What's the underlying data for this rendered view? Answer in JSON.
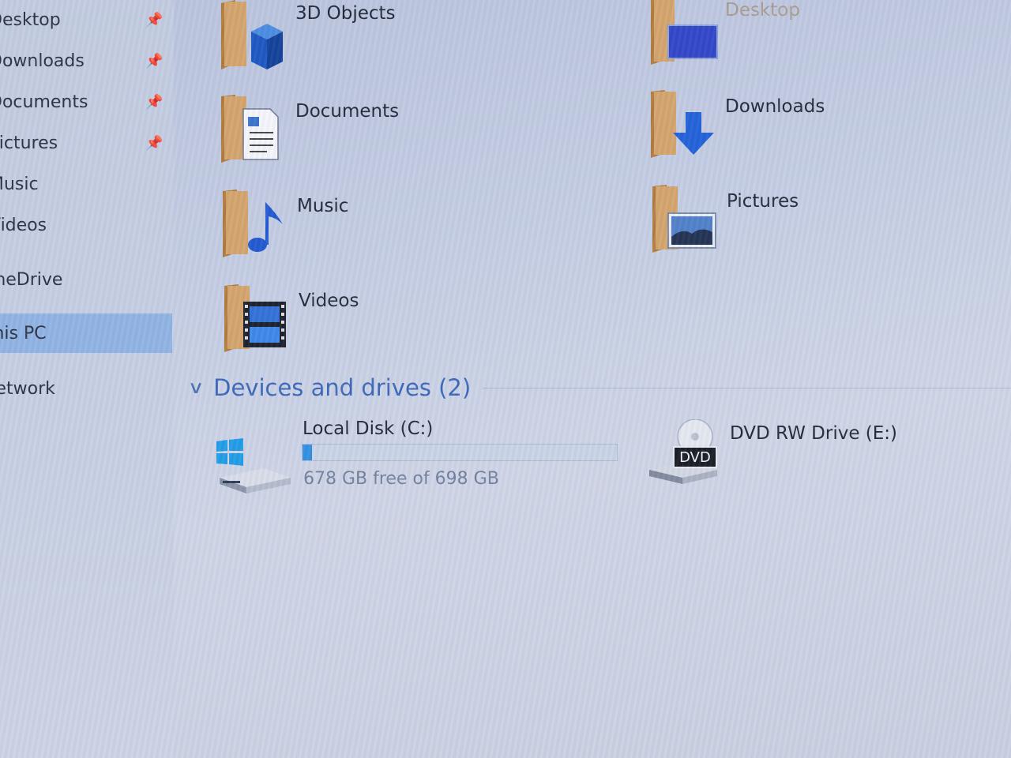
{
  "nav": {
    "items": [
      {
        "label": "Desktop",
        "pinned": true
      },
      {
        "label": "Downloads",
        "pinned": true
      },
      {
        "label": "Documents",
        "pinned": true
      },
      {
        "label": "Pictures",
        "pinned": true
      },
      {
        "label": "Music",
        "pinned": false
      },
      {
        "label": "Videos",
        "pinned": false
      },
      {
        "label": "OneDrive",
        "pinned": false
      },
      {
        "label": "This PC",
        "pinned": false,
        "selected": true
      },
      {
        "label": "Network",
        "pinned": false
      }
    ],
    "pin_glyph": "📌"
  },
  "folders": [
    {
      "label": "3D Objects",
      "icon": "3d-objects-folder-icon"
    },
    {
      "label": "Desktop",
      "icon": "desktop-folder-icon"
    },
    {
      "label": "Documents",
      "icon": "documents-folder-icon"
    },
    {
      "label": "Downloads",
      "icon": "downloads-folder-icon"
    },
    {
      "label": "Music",
      "icon": "music-folder-icon"
    },
    {
      "label": "Pictures",
      "icon": "pictures-folder-icon"
    },
    {
      "label": "Videos",
      "icon": "videos-folder-icon"
    }
  ],
  "devices": {
    "chevron": "∨",
    "title": "Devices and drives (2)",
    "drives": [
      {
        "name": "Local Disk (C:)",
        "free_text": "678 GB free of 698 GB",
        "used_fraction": 0.029,
        "icon": "windows-drive-icon"
      },
      {
        "name": "DVD RW Drive (E:)",
        "badge": "DVD",
        "icon": "dvd-drive-icon"
      }
    ]
  },
  "colors": {
    "accent": "#3a66b8",
    "selection": "#8fb3e3",
    "usage_fill": "#2f8ee0"
  }
}
